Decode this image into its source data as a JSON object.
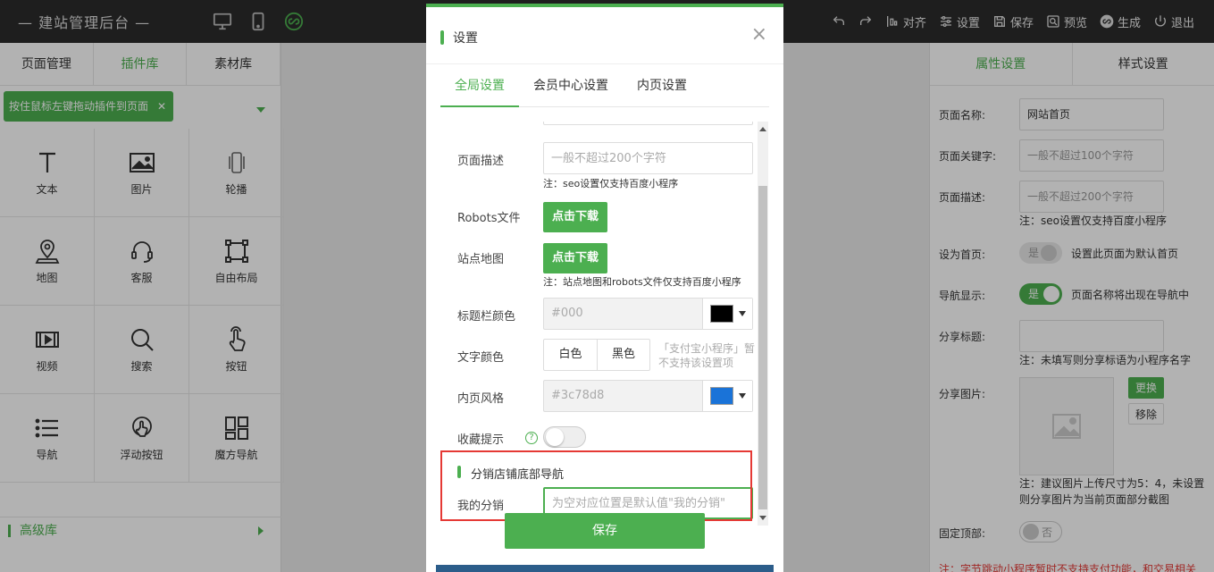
{
  "topbar": {
    "brand": "— 建站管理后台 —",
    "icons": [
      "desktop-icon",
      "mobile-icon",
      "link-icon"
    ],
    "actions": [
      {
        "name": "undo",
        "label": "",
        "icon": "undo-icon"
      },
      {
        "name": "redo",
        "label": "",
        "icon": "redo-icon"
      },
      {
        "name": "align",
        "label": "对齐",
        "icon": "align-icon"
      },
      {
        "name": "settings",
        "label": "设置",
        "icon": "sliders-icon"
      },
      {
        "name": "save",
        "label": "保存",
        "icon": "save-icon"
      },
      {
        "name": "preview",
        "label": "预览",
        "icon": "preview-icon"
      },
      {
        "name": "generate",
        "label": "生成",
        "icon": "generate-icon"
      },
      {
        "name": "logout",
        "label": "退出",
        "icon": "power-icon"
      }
    ]
  },
  "left_panel": {
    "tabs": [
      "页面管理",
      "插件库",
      "素材库"
    ],
    "active_tab": 1,
    "hint": "按住鼠标左键拖动插件到页面",
    "hint_close": "✕",
    "plugins": [
      {
        "label": "文本",
        "icon": "text-icon"
      },
      {
        "label": "图片",
        "icon": "image-icon"
      },
      {
        "label": "轮播",
        "icon": "carousel-icon"
      },
      {
        "label": "地图",
        "icon": "map-pin-icon"
      },
      {
        "label": "客服",
        "icon": "headset-icon"
      },
      {
        "label": "自由布局",
        "icon": "free-layout-icon"
      },
      {
        "label": "视频",
        "icon": "video-icon"
      },
      {
        "label": "搜索",
        "icon": "search-icon"
      },
      {
        "label": "按钮",
        "icon": "tap-icon"
      },
      {
        "label": "导航",
        "icon": "list-icon"
      },
      {
        "label": "浮动按钮",
        "icon": "float-button-icon"
      },
      {
        "label": "魔方导航",
        "icon": "cube-nav-icon"
      }
    ],
    "advanced": "高级库"
  },
  "right_panel": {
    "tabs": [
      "属性设置",
      "样式设置"
    ],
    "page_name_label": "页面名称:",
    "page_name_value": "网站首页",
    "keywords_label": "页面关键字:",
    "keywords_placeholder": "一般不超过100个字符",
    "desc_label": "页面描述:",
    "desc_placeholder": "一般不超过200个字符",
    "desc_note": "注：seo设置仅支持百度小程序",
    "home_label": "设为首页:",
    "home_toggle": "是",
    "home_note": "设置此页面为默认首页",
    "nav_label": "导航显示:",
    "nav_toggle": "是",
    "nav_note": "页面名称将出现在导航中",
    "share_title_label": "分享标题:",
    "share_title_note": "注：未填写则分享标语为小程序名字",
    "share_img_label": "分享图片:",
    "change_btn": "更换",
    "remove_btn": "移除",
    "share_img_note": "注：建议图片上传尺寸为5：4，未设置则分享图片为当前页面部分截图",
    "fixed_top_label": "固定顶部:",
    "fixed_top_toggle": "否",
    "warning": "注：字节跳动小程序暂时不支持支付功能，和交易相关"
  },
  "modal": {
    "title": "设置",
    "close": "×",
    "tabs": [
      "全局设置",
      "会员中心设置",
      "内页设置"
    ],
    "active_tab": 0,
    "fields": {
      "desc_label": "页面描述",
      "desc_placeholder": "一般不超过200个字符",
      "desc_note": "注：seo设置仅支持百度小程序",
      "robots_label": "Robots文件",
      "robots_btn": "点击下载",
      "sitemap_label": "站点地图",
      "sitemap_btn": "点击下载",
      "sitemap_note": "注：站点地图和robots文件仅支持百度小程序",
      "titlebar_color_label": "标题栏颜色",
      "titlebar_color_value": "#000",
      "text_color_label": "文字颜色",
      "text_color_white": "白色",
      "text_color_black": "黑色",
      "text_color_note": "「支付宝小程序」暂不支持该设置项",
      "inner_style_label": "内页风格",
      "inner_style_value": "#3c78d8",
      "favorite_label": "收藏提示",
      "favorite_help": "?",
      "section_title": "分销店铺底部导航",
      "my_dist_label": "我的分销",
      "my_dist_placeholder": "为空对应位置是默认值\"我的分销\""
    },
    "save_label": "保存"
  },
  "colors": {
    "accent": "#4caf50",
    "topbar": "#2b2b2b",
    "highlight": "#e53935",
    "titlebar_swatch": "#000000",
    "inner_swatch": "#1a73d8"
  }
}
